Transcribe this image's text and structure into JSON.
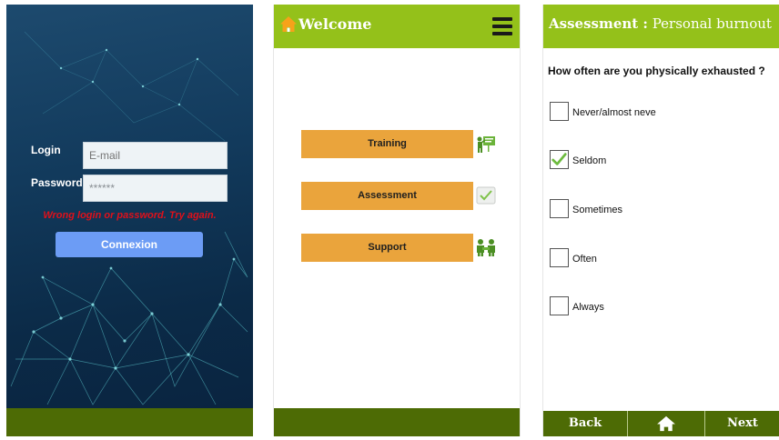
{
  "login": {
    "login_label": "Login",
    "password_label": "Password",
    "email_placeholder": "E-mail",
    "password_value": "******",
    "error_message": "Wrong login or password. Try again.",
    "connect_button": "Connexion"
  },
  "welcome": {
    "title": "Welcome",
    "buttons": [
      {
        "label": "Training",
        "icon": "training-board-icon"
      },
      {
        "label": "Assessment",
        "icon": "checkmark-icon"
      },
      {
        "label": "Support",
        "icon": "support-people-icon"
      }
    ]
  },
  "assessment": {
    "title_bold": "Assessment :",
    "title_rest": " Personal burnout",
    "question": "How often are you physically exhausted ?",
    "options": [
      {
        "label": "Never/almost neve",
        "checked": false
      },
      {
        "label": "Seldom",
        "checked": true
      },
      {
        "label": "Sometimes",
        "checked": false
      },
      {
        "label": "Often",
        "checked": false
      },
      {
        "label": "Always",
        "checked": false
      }
    ],
    "footer": {
      "back": "Back",
      "next": "Next"
    }
  },
  "colors": {
    "header_green": "#94c11a",
    "footer_green": "#4d6b05",
    "menu_orange": "#eaa43c",
    "login_button_blue": "#6c9cf5",
    "error_red": "#e0101a"
  }
}
